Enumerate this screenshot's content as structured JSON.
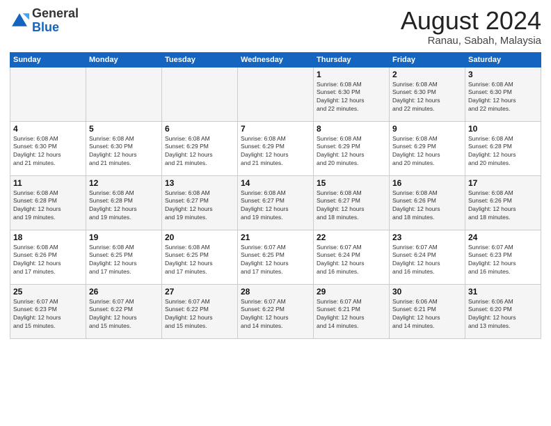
{
  "header": {
    "logo_general": "General",
    "logo_blue": "Blue",
    "month_year": "August 2024",
    "location": "Ranau, Sabah, Malaysia"
  },
  "weekdays": [
    "Sunday",
    "Monday",
    "Tuesday",
    "Wednesday",
    "Thursday",
    "Friday",
    "Saturday"
  ],
  "weeks": [
    [
      {
        "day": "",
        "info": ""
      },
      {
        "day": "",
        "info": ""
      },
      {
        "day": "",
        "info": ""
      },
      {
        "day": "",
        "info": ""
      },
      {
        "day": "1",
        "info": "Sunrise: 6:08 AM\nSunset: 6:30 PM\nDaylight: 12 hours\nand 22 minutes."
      },
      {
        "day": "2",
        "info": "Sunrise: 6:08 AM\nSunset: 6:30 PM\nDaylight: 12 hours\nand 22 minutes."
      },
      {
        "day": "3",
        "info": "Sunrise: 6:08 AM\nSunset: 6:30 PM\nDaylight: 12 hours\nand 22 minutes."
      }
    ],
    [
      {
        "day": "4",
        "info": "Sunrise: 6:08 AM\nSunset: 6:30 PM\nDaylight: 12 hours\nand 21 minutes."
      },
      {
        "day": "5",
        "info": "Sunrise: 6:08 AM\nSunset: 6:30 PM\nDaylight: 12 hours\nand 21 minutes."
      },
      {
        "day": "6",
        "info": "Sunrise: 6:08 AM\nSunset: 6:29 PM\nDaylight: 12 hours\nand 21 minutes."
      },
      {
        "day": "7",
        "info": "Sunrise: 6:08 AM\nSunset: 6:29 PM\nDaylight: 12 hours\nand 21 minutes."
      },
      {
        "day": "8",
        "info": "Sunrise: 6:08 AM\nSunset: 6:29 PM\nDaylight: 12 hours\nand 20 minutes."
      },
      {
        "day": "9",
        "info": "Sunrise: 6:08 AM\nSunset: 6:29 PM\nDaylight: 12 hours\nand 20 minutes."
      },
      {
        "day": "10",
        "info": "Sunrise: 6:08 AM\nSunset: 6:28 PM\nDaylight: 12 hours\nand 20 minutes."
      }
    ],
    [
      {
        "day": "11",
        "info": "Sunrise: 6:08 AM\nSunset: 6:28 PM\nDaylight: 12 hours\nand 19 minutes."
      },
      {
        "day": "12",
        "info": "Sunrise: 6:08 AM\nSunset: 6:28 PM\nDaylight: 12 hours\nand 19 minutes."
      },
      {
        "day": "13",
        "info": "Sunrise: 6:08 AM\nSunset: 6:27 PM\nDaylight: 12 hours\nand 19 minutes."
      },
      {
        "day": "14",
        "info": "Sunrise: 6:08 AM\nSunset: 6:27 PM\nDaylight: 12 hours\nand 19 minutes."
      },
      {
        "day": "15",
        "info": "Sunrise: 6:08 AM\nSunset: 6:27 PM\nDaylight: 12 hours\nand 18 minutes."
      },
      {
        "day": "16",
        "info": "Sunrise: 6:08 AM\nSunset: 6:26 PM\nDaylight: 12 hours\nand 18 minutes."
      },
      {
        "day": "17",
        "info": "Sunrise: 6:08 AM\nSunset: 6:26 PM\nDaylight: 12 hours\nand 18 minutes."
      }
    ],
    [
      {
        "day": "18",
        "info": "Sunrise: 6:08 AM\nSunset: 6:26 PM\nDaylight: 12 hours\nand 17 minutes."
      },
      {
        "day": "19",
        "info": "Sunrise: 6:08 AM\nSunset: 6:25 PM\nDaylight: 12 hours\nand 17 minutes."
      },
      {
        "day": "20",
        "info": "Sunrise: 6:08 AM\nSunset: 6:25 PM\nDaylight: 12 hours\nand 17 minutes."
      },
      {
        "day": "21",
        "info": "Sunrise: 6:07 AM\nSunset: 6:25 PM\nDaylight: 12 hours\nand 17 minutes."
      },
      {
        "day": "22",
        "info": "Sunrise: 6:07 AM\nSunset: 6:24 PM\nDaylight: 12 hours\nand 16 minutes."
      },
      {
        "day": "23",
        "info": "Sunrise: 6:07 AM\nSunset: 6:24 PM\nDaylight: 12 hours\nand 16 minutes."
      },
      {
        "day": "24",
        "info": "Sunrise: 6:07 AM\nSunset: 6:23 PM\nDaylight: 12 hours\nand 16 minutes."
      }
    ],
    [
      {
        "day": "25",
        "info": "Sunrise: 6:07 AM\nSunset: 6:23 PM\nDaylight: 12 hours\nand 15 minutes."
      },
      {
        "day": "26",
        "info": "Sunrise: 6:07 AM\nSunset: 6:22 PM\nDaylight: 12 hours\nand 15 minutes."
      },
      {
        "day": "27",
        "info": "Sunrise: 6:07 AM\nSunset: 6:22 PM\nDaylight: 12 hours\nand 15 minutes."
      },
      {
        "day": "28",
        "info": "Sunrise: 6:07 AM\nSunset: 6:22 PM\nDaylight: 12 hours\nand 14 minutes."
      },
      {
        "day": "29",
        "info": "Sunrise: 6:07 AM\nSunset: 6:21 PM\nDaylight: 12 hours\nand 14 minutes."
      },
      {
        "day": "30",
        "info": "Sunrise: 6:06 AM\nSunset: 6:21 PM\nDaylight: 12 hours\nand 14 minutes."
      },
      {
        "day": "31",
        "info": "Sunrise: 6:06 AM\nSunset: 6:20 PM\nDaylight: 12 hours\nand 13 minutes."
      }
    ]
  ]
}
